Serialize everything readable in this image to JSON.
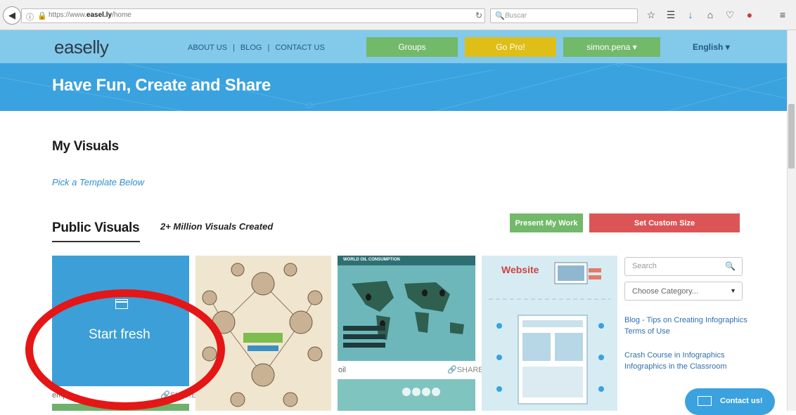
{
  "browser": {
    "url_prefix": "https://www.",
    "url_domain": "easel.ly",
    "url_path": "/home",
    "search_placeholder": "Buscar",
    "icons": [
      "back-icon",
      "info-icon",
      "lock-icon",
      "reload-icon",
      "search-icon",
      "star-icon",
      "reading-list-icon",
      "download-icon",
      "home-icon",
      "pocket-icon",
      "addon-icon",
      "menu-icon"
    ]
  },
  "site_nav": {
    "logo": "easelly",
    "links": [
      "ABOUT US",
      "BLOG",
      "CONTACT US"
    ],
    "separator": "|",
    "groups_label": "Groups",
    "gopro_label": "Go Pro!",
    "user_label": "simon.pena ▾",
    "language_label": "English",
    "colors": {
      "nav_bg": "#83c9ea",
      "groups": "#72b96a",
      "gopro": "#dfbe18",
      "user": "#72b96a"
    }
  },
  "hero": {
    "title": "Have Fun, Create and Share",
    "color": "#3aa2de"
  },
  "main": {
    "my_visuals_heading": "My Visuals",
    "pick_template_link": "Pick a Template Below",
    "public_visuals_heading": "Public Visuals",
    "million_note": "2+ Million Visuals Created",
    "present_button": "Present My Work",
    "custom_size_button": "Set Custom Size"
  },
  "cards": [
    {
      "label": "Start fresh",
      "caption": "empty",
      "share": "SHARE"
    },
    {
      "caption": "",
      "share": ""
    },
    {
      "title": "WORLD OIL CONSUMPTION",
      "caption": "oil",
      "share": "SHARE"
    },
    {
      "title": "Website",
      "caption": "",
      "share": ""
    }
  ],
  "sidebar": {
    "search_placeholder": "Search",
    "category_placeholder": "Choose Category...",
    "links": [
      "Blog - Tips on Creating Infographics",
      "Terms of Use",
      "Crash Course in Infographics",
      "Infographics in the Classroom"
    ],
    "contact_label": "Contact us!"
  }
}
